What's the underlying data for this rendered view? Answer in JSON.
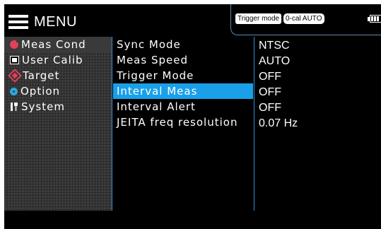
{
  "header": {
    "menu_label": "MENU",
    "trigger_badge": "Trigger mode",
    "cal_badge": "0-cal AUTO",
    "battery_icon": "battery-icon"
  },
  "sidebar": {
    "items": [
      {
        "label": "Meas Cond",
        "icon": "meas-cond-icon",
        "active": true
      },
      {
        "label": "User Calib",
        "icon": "user-calib-icon",
        "active": false
      },
      {
        "label": "Target",
        "icon": "target-icon",
        "active": false
      },
      {
        "label": "Option",
        "icon": "option-icon",
        "active": false
      },
      {
        "label": "System",
        "icon": "system-icon",
        "active": false
      }
    ]
  },
  "settings": [
    {
      "name": "Sync Mode",
      "value": "NTSC",
      "selected": false
    },
    {
      "name": "Meas Speed",
      "value": "AUTO",
      "selected": false
    },
    {
      "name": "Trigger Mode",
      "value": "OFF",
      "selected": false
    },
    {
      "name": "Interval Meas",
      "value": "OFF",
      "selected": true
    },
    {
      "name": "Interval Alert",
      "value": "OFF",
      "selected": false
    },
    {
      "name": "JEITA freq resolution",
      "value": "0.07 Hz",
      "selected": false
    }
  ],
  "colors": {
    "selection": "#1aa0e8",
    "divider": "#2e8fd6",
    "accent_red": "#e0405a",
    "accent_blue": "#2aa9e0"
  }
}
